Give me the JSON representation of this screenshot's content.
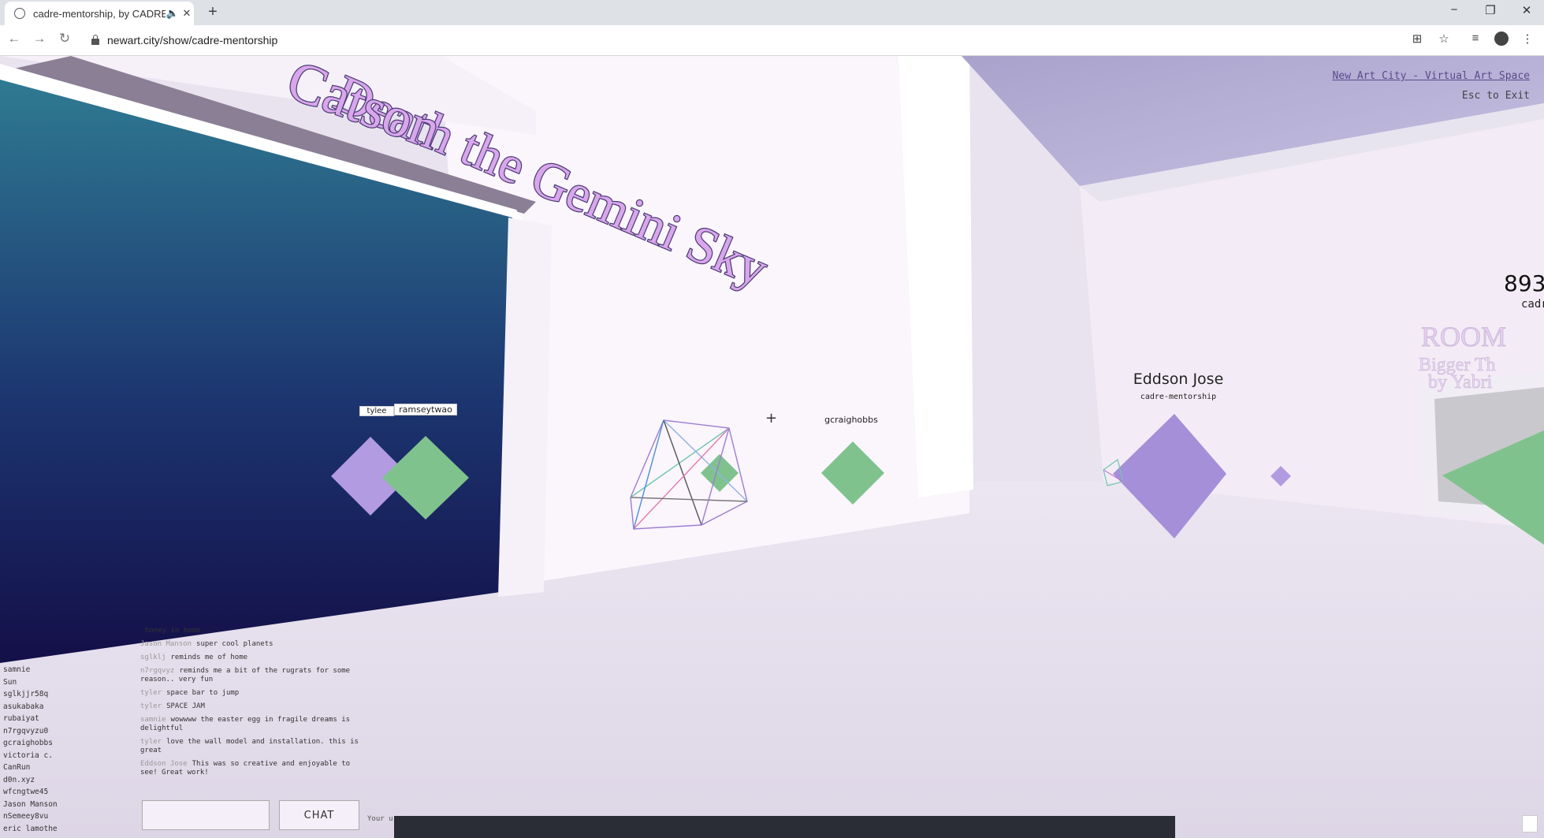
{
  "browser": {
    "tab_title": "cadre-mentorship, by CADRE",
    "new_tab": "+",
    "url": "newart.city/show/cadre-mentorship",
    "window": {
      "minimize": "−",
      "restore": "❐",
      "close": "✕"
    }
  },
  "scene": {
    "wall_line1": "Death the Gemini Sky",
    "wall_line2": "Catson",
    "hud_link": "New Art City - Virtual Art Space",
    "hud_exit": "Esc to Exit",
    "avatar_main_name": "Eddson Jose",
    "avatar_main_sub": "cadre-mentorship",
    "avatar_gcraig": "gcraighobbs",
    "left_tags": [
      "tylee",
      "ramseytwao"
    ],
    "crosshair": "+",
    "room_title": "ROOM",
    "room_sub1": "Bigger Th",
    "room_sub2": "by Yabri",
    "count": "893",
    "count_sub": "cadr"
  },
  "chat": {
    "messages": [
      {
        "who": "",
        "text": "honey in home"
      },
      {
        "who": "Jason Manson",
        "text": "super cool planets"
      },
      {
        "who": "sglklj",
        "text": "reminds me of home"
      },
      {
        "who": "n7rgqvyz",
        "text": "reminds me a bit of the rugrats for some reason.. very fun"
      },
      {
        "who": "tyler",
        "text": "space bar to jump"
      },
      {
        "who": "tyler",
        "text": "SPACE JAM"
      },
      {
        "who": "samnie",
        "text": "wowwww the easter egg in fragile dreams is delightful"
      },
      {
        "who": "tyler",
        "text": "love the wall model and installation. this is great"
      },
      {
        "who": "Eddson Jose",
        "text": "This was so creative and enjoyable to see! Great work!"
      }
    ],
    "button": "CHAT",
    "your_label": "Your u"
  },
  "users": [
    "samnie",
    "Sun",
    "sglkjjr58q",
    "asukabaka",
    "rubaiyat",
    "n7rgqvyzu0",
    "gcraighobbs",
    "victoria c.",
    "CanRun",
    "d0n.xyz",
    "wfcngtwe45",
    "Jason Manson",
    "nSemeey8vu",
    "eric lamothe"
  ]
}
